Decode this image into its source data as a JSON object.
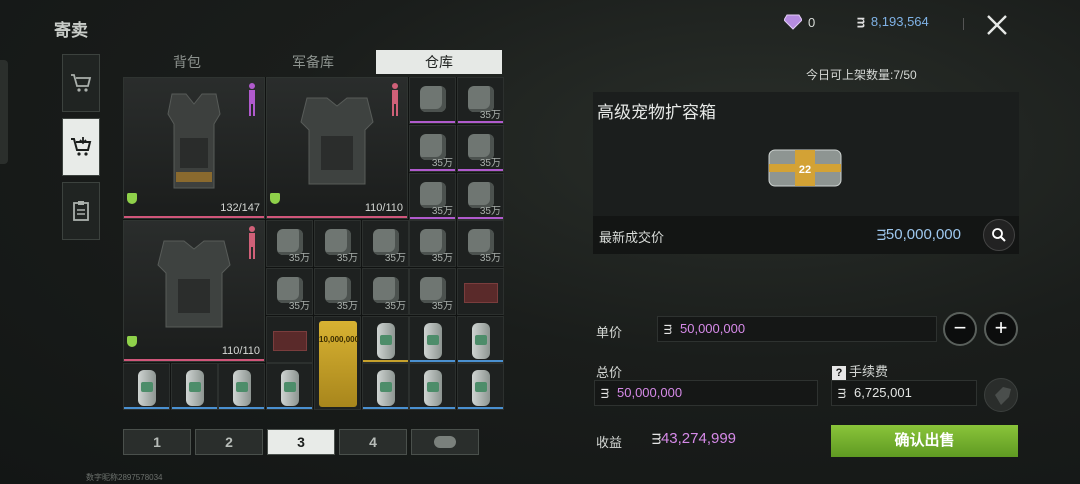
{
  "title": "寄卖",
  "tabs": [
    {
      "label": "背包"
    },
    {
      "label": "军备库"
    },
    {
      "label": "仓库"
    }
  ],
  "active_tab": "仓库",
  "inventory": {
    "vest1_qty": "132/147",
    "vest2_qty": "110/110",
    "vest3_qty": "110/110",
    "potion_label": "35万",
    "gold_bar_label": "10,000,000"
  },
  "pages": [
    "1",
    "2",
    "3",
    "4"
  ],
  "active_page": "3",
  "player_id": "数字昵称2897578034",
  "currency": {
    "diamonds": "0",
    "coins": "8,193,564"
  },
  "daily_limit": "今日可上架数量:7/50",
  "item": {
    "name": "高级宠物扩容箱",
    "crate_number": "22",
    "latest_price_label": "最新成交价",
    "latest_price": "50,000,000"
  },
  "form": {
    "unit_price_label": "单价",
    "unit_price": "50,000,000",
    "total_label": "总价",
    "total_value": "50,000,000",
    "fee_label": "手续费",
    "fee_value": "6,725,001",
    "income_label": "收益",
    "income_value": "43,274,999",
    "confirm_label": "确认出售",
    "minus": "−",
    "plus": "+"
  },
  "colors": {
    "accent_green": "#7ab532",
    "price_blue": "#9fc8ee",
    "income_purple": "#d68ae8",
    "health_pink": "#d0567a"
  },
  "icons": {
    "diamond": "diamond-icon",
    "coin": "coin-icon",
    "close": "close-icon",
    "cart": "cart-icon",
    "sell_cart": "sell-cart-icon",
    "clipboard": "clipboard-icon",
    "search": "search-icon"
  }
}
